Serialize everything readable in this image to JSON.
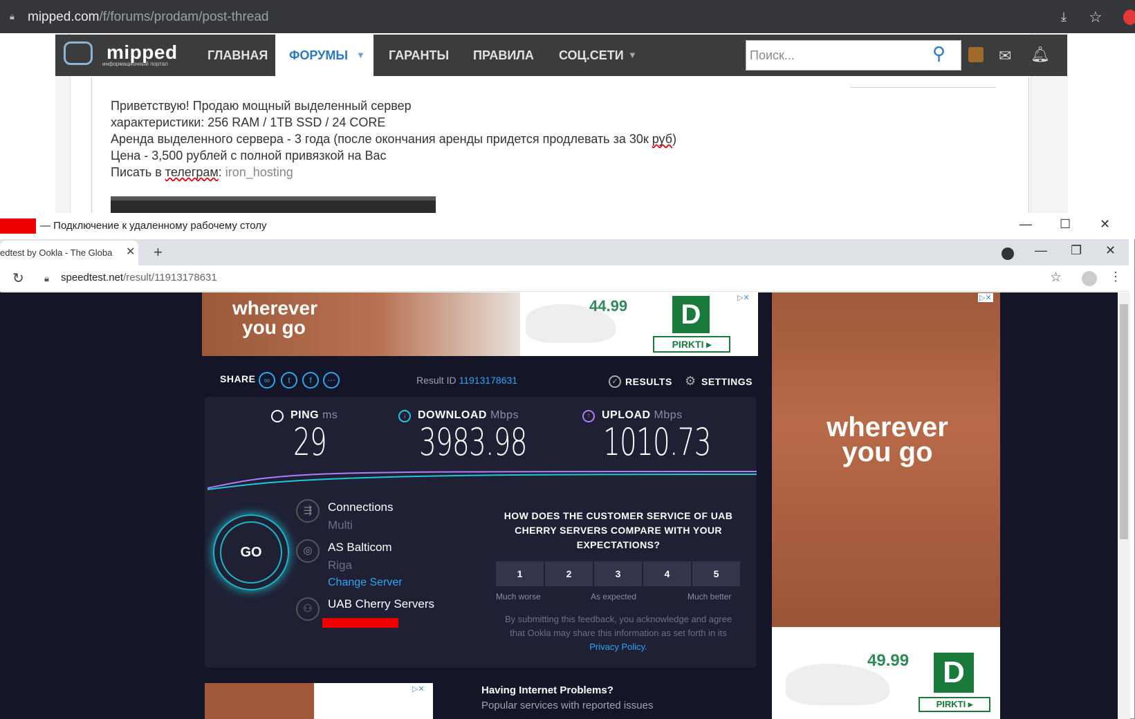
{
  "outer_browser": {
    "url_domain": "mipped.com",
    "url_path": "/f/forums/prodam/post-thread"
  },
  "forum": {
    "logo": "mipped",
    "logo_sub": "информационный портал",
    "nav": [
      "ГЛАВНАЯ",
      "ФОРУМЫ",
      "ГАРАНТЫ",
      "ПРАВИЛА",
      "СОЦ.СЕТИ"
    ],
    "search_placeholder": "Поиск...",
    "post": {
      "line1": "Приветствую! Продаю мощный выделенный сервер",
      "line2": "характеристики: 256 RAM / 1TB SSD / 24 CORE",
      "line3_a": "Аренда выделенного сервера - 3 года (после окончания аренды придется продлевать за 30к ",
      "line3_b": "руб",
      "line3_c": ")",
      "line4": "Цена -  3,500 рублей с полной привязкой на Вас",
      "line5_a": "Писать в ",
      "line5_b": "телеграм",
      "line5_c": ": ",
      "line5_d": "iron_hosting"
    }
  },
  "rdp": {
    "title": "— Подключение к удаленному рабочему столу"
  },
  "inner_browser": {
    "tab_title": "edtest by Ookla - The Globa",
    "url_domain": "speedtest.net",
    "url_path": "/result/11913178631"
  },
  "speedtest": {
    "share_label": "SHARE",
    "result_id_label": "Result ID",
    "result_id": "11913178631",
    "results_label": "RESULTS",
    "settings_label": "SETTINGS",
    "ping": {
      "label": "PING",
      "unit": "ms",
      "value": "29"
    },
    "download": {
      "label": "DOWNLOAD",
      "unit": "Mbps",
      "value": "3983.98"
    },
    "upload": {
      "label": "UPLOAD",
      "unit": "Mbps",
      "value": "1010.73"
    },
    "go_label": "GO",
    "connections_label": "Connections",
    "connections_value": "Multi",
    "isp": "AS Balticom",
    "isp_city": "Riga",
    "change_server": "Change Server",
    "host": "UAB Cherry Servers",
    "question": "HOW DOES THE CUSTOMER SERVICE OF UAB CHERRY SERVERS COMPARE WITH YOUR EXPECTATIONS?",
    "ratings": [
      "1",
      "2",
      "3",
      "4",
      "5"
    ],
    "rating_labels": [
      "Much worse",
      "As expected",
      "Much better"
    ],
    "disclaimer": "By submitting this feedback, you acknowledge and agree that Ookla may share this information as set forth in its ",
    "privacy_link": "Privacy Policy.",
    "problems_title": "Having Internet Problems?",
    "problems_sub": "Popular services with reported issues"
  },
  "ads": {
    "slogan": "wherever you go",
    "price_top": "44.99",
    "price_right": "49.99",
    "brand_letter": "D",
    "cta": "PIRKTI ▸"
  },
  "colors": {
    "speedtest_bg": "#141526",
    "accent_blue": "#2ea6f7",
    "go_ring": "#1fb5c7",
    "forum_nav": "#3b3c3e"
  }
}
